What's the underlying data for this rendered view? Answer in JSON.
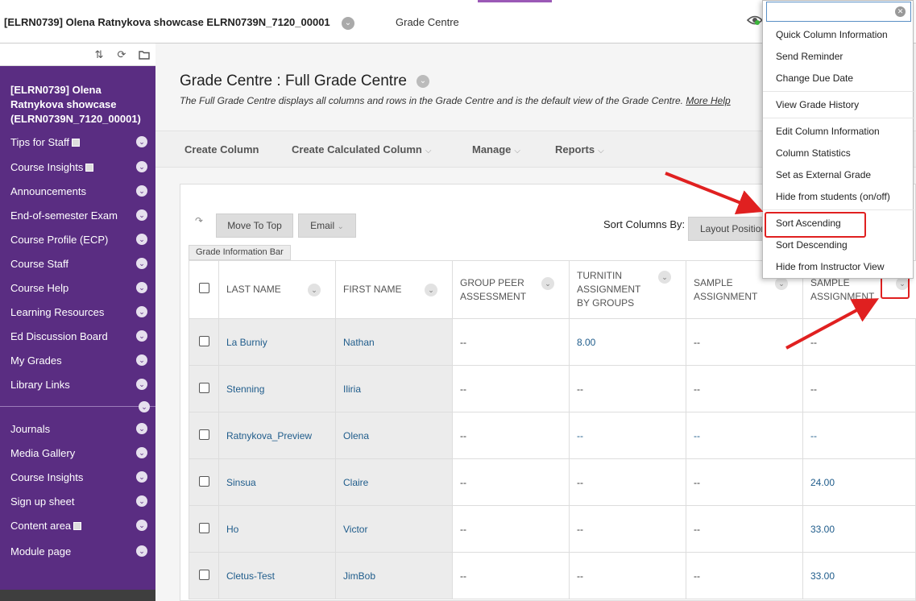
{
  "topbar": {
    "course_title": "[ELRN0739] Olena Ratnykova showcase ELRN0739N_7120_00001",
    "tab_title": "Grade Centre",
    "accent_color": "#9b59b6"
  },
  "sidebar": {
    "background": "#5a2d82",
    "course_name": "[ELRN0739] Olena Ratnykova showcase (ELRN0739N_7120_00001)",
    "items": [
      {
        "label": "Tips for Staff"
      },
      {
        "label": "Course Insights"
      },
      {
        "label": "Announcements"
      },
      {
        "label": "End-of-semester Exam"
      },
      {
        "label": "Course Profile (ECP)"
      },
      {
        "label": "Course Staff"
      },
      {
        "label": "Course Help"
      },
      {
        "label": "Learning Resources"
      },
      {
        "label": "Ed Discussion Board"
      },
      {
        "label": "My Grades"
      },
      {
        "label": "Library Links"
      }
    ],
    "items2": [
      {
        "label": "Journals"
      },
      {
        "label": "Media Gallery"
      },
      {
        "label": "Course Insights"
      },
      {
        "label": "Sign up sheet"
      },
      {
        "label": "Content area"
      },
      {
        "label": "Module page"
      }
    ]
  },
  "main": {
    "title": "Grade Centre : Full Grade Centre",
    "description": "The Full Grade Centre displays all columns and rows in the Grade Centre and is the default view of the Grade Centre.",
    "help_link": "More Help",
    "actions": {
      "create_column": "Create Column",
      "create_calculated": "Create Calculated Column",
      "manage": "Manage",
      "reports": "Reports"
    },
    "toolbar": {
      "move_to_top": "Move To Top",
      "email": "Email",
      "sort_label": "Sort Columns By:",
      "layout_position": "Layout Position"
    },
    "grade_info_bar": "Grade Information Bar",
    "columns": {
      "last_name": "LAST NAME",
      "first_name": "FIRST NAME",
      "c1a": "GROUP PEER",
      "c1b": "ASSESSMENT",
      "c2a": "TURNITIN",
      "c2b": "ASSIGNMENT",
      "c2c": "BY GROUPS",
      "c3a": "SAMPLE",
      "c3b": "ASSIGNMENT",
      "c4a": "SAMPLE",
      "c4b": "ASSIGNMENT"
    },
    "rows": [
      {
        "last": "La Burniy",
        "first": "Nathan",
        "c1": "--",
        "c2": "8.00",
        "c3": "--",
        "c4": "--"
      },
      {
        "last": "Stenning",
        "first": "Iliria",
        "c1": "--",
        "c2": "--",
        "c3": "--",
        "c4": "--"
      },
      {
        "last": "Ratnykova_Preview",
        "first": "Olena",
        "c1": "--",
        "c2": "--",
        "c3": "--",
        "c4": "--"
      },
      {
        "last": "Sinsua",
        "first": "Claire",
        "c1": "--",
        "c2": "--",
        "c3": "--",
        "c4": "24.00"
      },
      {
        "last": "Ho",
        "first": "Victor",
        "c1": "--",
        "c2": "--",
        "c3": "--",
        "c4": "33.00"
      },
      {
        "last": "Cletus-Test",
        "first": "JimBob",
        "c1": "--",
        "c2": "--",
        "c3": "--",
        "c4": "33.00"
      }
    ]
  },
  "context_menu": {
    "search_value": "",
    "items": [
      "Quick Column Information",
      "Send Reminder",
      "Change Due Date",
      "View Grade History",
      "Edit Column Information",
      "Column Statistics",
      "Set as External Grade",
      "Hide from students (on/off)",
      "Sort Ascending",
      "Sort Descending",
      "Hide from Instructor View"
    ],
    "highlight_color": "#e02020"
  }
}
